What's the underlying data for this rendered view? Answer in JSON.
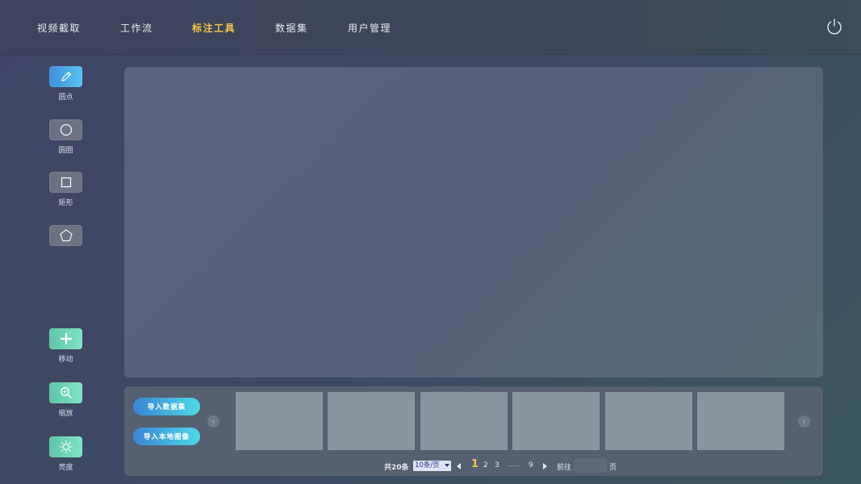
{
  "nav": {
    "items": [
      {
        "label": "视频截取",
        "active": false
      },
      {
        "label": "工作流",
        "active": false
      },
      {
        "label": "标注工具",
        "active": true
      },
      {
        "label": "数据集",
        "active": false
      },
      {
        "label": "用户管理",
        "active": false
      }
    ],
    "power_icon": "power-icon"
  },
  "tools": {
    "point": {
      "label": "圆点",
      "icon": "pencil-icon"
    },
    "circle": {
      "label": "圆圈",
      "icon": "circle-icon"
    },
    "rect": {
      "label": "矩形",
      "icon": "square-icon"
    },
    "polygon": {
      "label": "",
      "icon": "pentagon-icon"
    },
    "move": {
      "label": "移动",
      "icon": "plus-icon"
    },
    "zoom": {
      "label": "缩放",
      "icon": "zoom-icon"
    },
    "brightness": {
      "label": "亮度",
      "icon": "sun-icon"
    }
  },
  "bottom": {
    "import_dataset": "导入数据集",
    "import_local": "导入本地图像",
    "thumbnails_count": 6,
    "prev_arrow": "‹",
    "next_arrow": "›"
  },
  "pagination": {
    "total": "共20条",
    "page_size": "10条/页",
    "current": "1",
    "pages": [
      "2",
      "3"
    ],
    "ellipsis": "······",
    "last": "9",
    "goto_label": "前往",
    "goto_value": "",
    "page_suffix": "页"
  },
  "colors": {
    "active_nav": "#f3c64a",
    "blue_gradient_start": "#3e8fd9",
    "green_gradient_start": "#5fc7a4"
  }
}
